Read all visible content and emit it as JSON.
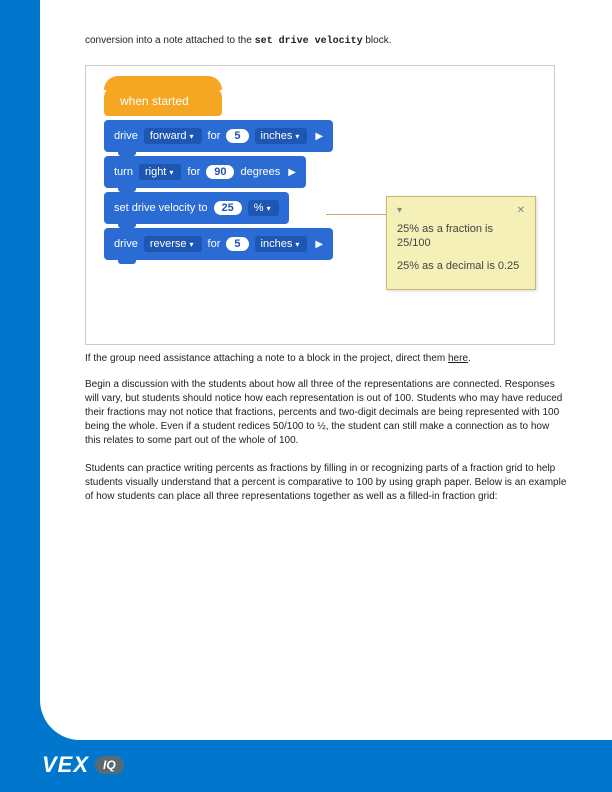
{
  "intro": {
    "prefix": "conversion into a note attached to the ",
    "code": "set drive velocity",
    "suffix": " block."
  },
  "blocks": {
    "hat": "when started",
    "b1": {
      "cmd": "drive",
      "dir": "forward",
      "for": "for",
      "val": "5",
      "unit": "inches"
    },
    "b2": {
      "cmd": "turn",
      "dir": "right",
      "for": "for",
      "val": "90",
      "unit": "degrees"
    },
    "b3": {
      "cmd": "set drive velocity to",
      "val": "25",
      "unit": "%"
    },
    "b4": {
      "cmd": "drive",
      "dir": "reverse",
      "for": "for",
      "val": "5",
      "unit": "inches"
    }
  },
  "note": {
    "collapse": "▾",
    "close": "✕",
    "line1": "25% as a fraction is 25/100",
    "line2": "25% as a decimal is 0.25"
  },
  "caption": {
    "prefix": "If the group need assistance attaching a note to a block in the project, direct them ",
    "link": "here",
    "suffix": "."
  },
  "para1": "Begin a discussion with the students about how all three of the representations are connected. Responses will vary, but students should notice how each representation is out of 100. Students who may have reduced their fractions may not notice that fractions, percents and two-digit decimals are being represented with 100 being the whole. Even if a student redices 50/100 to ½, the student can still make a connection as to how this relates to some part out of the whole of 100.",
  "para2": "Students can practice writing percents as fractions by filling in or recognizing parts of a fraction grid to help students visually understand that a percent is comparative to 100 by using graph paper. Below is an example of how students can place all three representations together as well as a filled-in fraction grid:",
  "footer": {
    "brand": "VEX",
    "sub": "IQ"
  }
}
